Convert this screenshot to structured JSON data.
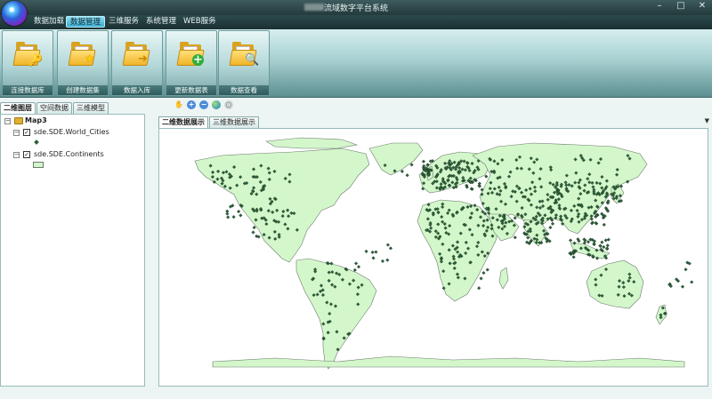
{
  "window": {
    "title": "流域数字平台系统",
    "minimize_glyph": "–",
    "maximize_glyph": "□",
    "close_glyph": "✕"
  },
  "menu": {
    "items": [
      {
        "label": "数据加载"
      },
      {
        "label": "数据管理"
      },
      {
        "label": "三维服务"
      },
      {
        "label": "系统管理"
      },
      {
        "label": "WEB服务"
      }
    ],
    "active_index": 1
  },
  "ribbon": {
    "buttons": [
      {
        "label": "连接数据库",
        "icon": "folder-key-icon",
        "badge": "🔑"
      },
      {
        "label": "创建数据集",
        "icon": "folder-star-icon",
        "badge": "★"
      },
      {
        "label": "数据入库",
        "icon": "folder-arrow-icon",
        "badge": "➜"
      },
      {
        "label": "更新数据表",
        "icon": "folder-add-icon",
        "badge": "+"
      },
      {
        "label": "数据查看",
        "icon": "folder-search-icon",
        "badge": "🔍"
      }
    ]
  },
  "left_panel": {
    "tabs": [
      {
        "label": "二维图层"
      },
      {
        "label": "空间数据"
      },
      {
        "label": "三维模型"
      }
    ],
    "tree": {
      "root": {
        "label": "Map3",
        "expander": "−"
      },
      "layers": [
        {
          "label": "sde.SDE.World_Cities",
          "checked": true,
          "expander": "−",
          "check_glyph": "✓"
        },
        {
          "label": "sde.SDE.Continents",
          "checked": true,
          "expander": "−",
          "check_glyph": "✓"
        }
      ]
    }
  },
  "map_toolbar": {
    "tools": [
      {
        "icon": "pan-hand-icon",
        "glyph": "✋"
      },
      {
        "icon": "zoom-in-icon",
        "glyph": "+"
      },
      {
        "icon": "zoom-out-icon",
        "glyph": "−"
      },
      {
        "icon": "globe-full-extent-icon",
        "glyph": "●"
      },
      {
        "icon": "identify-icon",
        "glyph": "○"
      }
    ]
  },
  "map_panel": {
    "tabs": [
      {
        "label": "二维数据展示"
      },
      {
        "label": "三维数据展示"
      }
    ],
    "dropdown_glyph": "▼"
  },
  "colors": {
    "continent_fill": "#d3f7cb",
    "continent_stroke": "#6c7a6c",
    "city_marker": "#2f5f3a",
    "ribbon_top": "#d6eeee",
    "ribbon_bottom": "#5d8f91",
    "titlebar": "#2c4a4c",
    "active_menu": "#3aa9cf"
  }
}
